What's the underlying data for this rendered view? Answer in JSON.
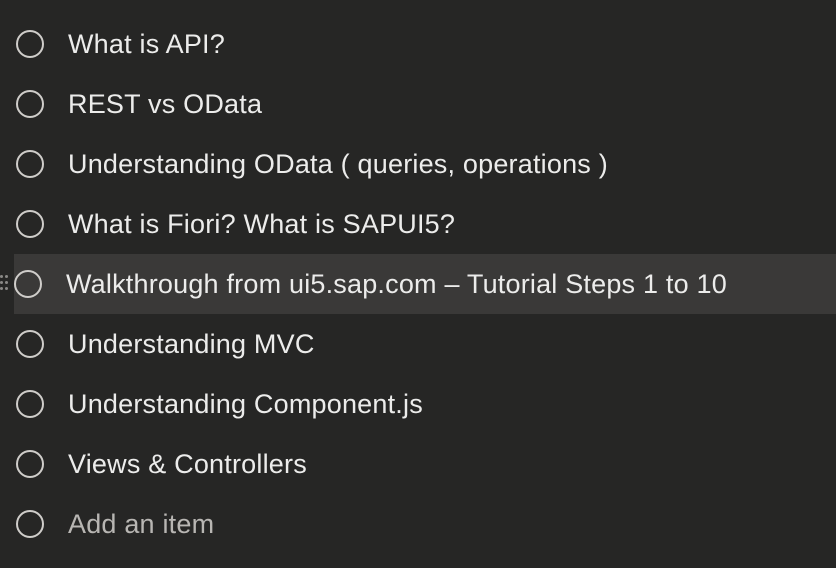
{
  "tasks": [
    {
      "label": "What is API?"
    },
    {
      "label": "REST vs OData"
    },
    {
      "label": "Understanding OData ( queries, operations )"
    },
    {
      "label": "What is Fiori? What is SAPUI5?"
    },
    {
      "label": "Walkthrough from ui5.sap.com – Tutorial Steps 1 to 10"
    },
    {
      "label": "Understanding MVC"
    },
    {
      "label": "Understanding Component.js"
    },
    {
      "label": "Views & Controllers"
    }
  ],
  "add_item": {
    "label": "Add an item"
  }
}
